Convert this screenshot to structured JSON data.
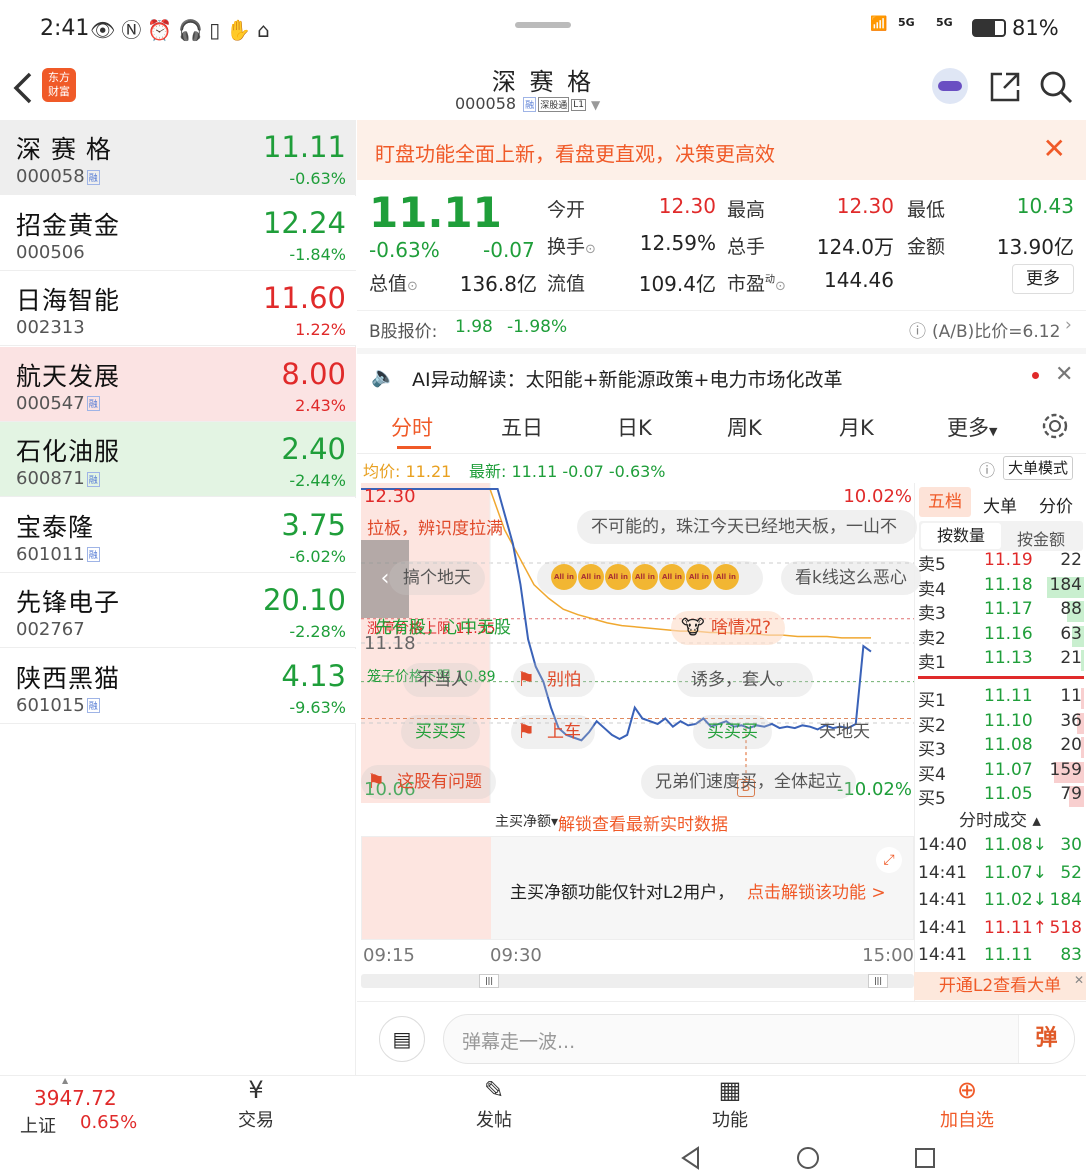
{
  "status": {
    "time": "2:41",
    "battery": "81%",
    "net1": "5G",
    "net2": "5G"
  },
  "header": {
    "title": "深 赛 格",
    "code": "000058",
    "tags": [
      "融",
      "深股通",
      "L1"
    ],
    "logo_line1": "东方",
    "logo_line2": "财富"
  },
  "watchlist": [
    {
      "name": "深 赛 格",
      "code": "000058",
      "rong": true,
      "price": "11.11",
      "change": "-0.63%",
      "dir": "down",
      "bg": "#eeeeee"
    },
    {
      "name": "招金黄金",
      "code": "000506",
      "rong": false,
      "price": "12.24",
      "change": "-1.84%",
      "dir": "down",
      "bg": "#ffffff"
    },
    {
      "name": "日海智能",
      "code": "002313",
      "rong": false,
      "price": "11.60",
      "change": "1.22%",
      "dir": "up",
      "bg": "#ffffff"
    },
    {
      "name": "航天发展",
      "code": "000547",
      "rong": true,
      "price": "8.00",
      "change": "2.43%",
      "dir": "up",
      "bg": "#fbe3e3"
    },
    {
      "name": "石化油服",
      "code": "600871",
      "rong": true,
      "price": "2.40",
      "change": "-2.44%",
      "dir": "down",
      "bg": "#e3f4e3"
    },
    {
      "name": "宝泰隆",
      "code": "601011",
      "rong": true,
      "price": "3.75",
      "change": "-6.02%",
      "dir": "down",
      "bg": "#ffffff"
    },
    {
      "name": "先锋电子",
      "code": "002767",
      "rong": false,
      "price": "20.10",
      "change": "-2.28%",
      "dir": "down",
      "bg": "#ffffff"
    },
    {
      "name": "陕西黑猫",
      "code": "601015",
      "rong": true,
      "price": "4.13",
      "change": "-9.63%",
      "dir": "down",
      "bg": "#ffffff"
    }
  ],
  "banner": {
    "text": "盯盘功能全面上新，看盘更直观，决策更高效"
  },
  "quote": {
    "price": "11.11",
    "pct": "-0.63%",
    "chg": "-0.07",
    "open_label": "今开",
    "open": "12.30",
    "high_label": "最高",
    "high": "12.30",
    "low_label": "最低",
    "low": "10.43",
    "turnover_label": "换手",
    "turnover": "12.59%",
    "volume_label": "总手",
    "volume": "124.0万",
    "amount_label": "金额",
    "amount": "13.90亿",
    "mcap_label": "总值",
    "mcap": "136.8亿",
    "float_label": "流值",
    "float": "109.4亿",
    "pe_label": "市盈",
    "pe_sup": "动",
    "pe": "144.46",
    "more": "更多",
    "bshare_label": "B股报价:",
    "bshare_price": "1.98",
    "bshare_pct": "-1.98%",
    "ab_ratio": "(A/B)比价=6.12"
  },
  "ai": {
    "text": "AI异动解读：太阳能+新能源政策+电力市场化改革"
  },
  "tabs": [
    "分时",
    "五日",
    "日K",
    "周K",
    "月K",
    "更多"
  ],
  "chart_header": {
    "avg_label": "均价:",
    "avg": "11.21",
    "latest_label": "最新:",
    "latest": "11.11",
    "chg": "-0.07",
    "pct": "-0.63%",
    "big_order": "大单模式"
  },
  "chart_data": {
    "type": "line",
    "x_ticks": [
      "09:15",
      "09:30",
      "15:00"
    ],
    "y_max_label": "12.30",
    "y_min_label": "10.06",
    "pct_max": "10.02%",
    "pct_min": "-10.02%",
    "ylim": [
      10.06,
      12.3
    ],
    "mid_label": "11.18",
    "price": [
      12.3,
      12.3,
      12.1,
      11.9,
      11.6,
      11.2,
      11.0,
      10.89,
      10.7,
      10.55,
      10.5,
      10.48,
      10.46,
      10.52,
      10.6,
      10.55,
      10.5,
      10.47,
      10.5,
      10.7,
      10.62,
      10.6,
      10.58,
      10.62,
      10.56,
      10.6,
      10.57,
      10.58,
      10.62,
      10.56,
      10.58,
      10.6,
      10.56,
      10.57,
      10.55,
      10.57,
      10.56,
      10.58,
      10.55,
      10.56,
      10.55,
      10.57,
      10.56,
      10.54,
      10.57,
      10.55,
      10.56,
      10.55,
      10.58,
      11.15,
      11.11
    ],
    "avg": [
      12.3,
      12.0,
      11.8,
      11.6,
      11.5,
      11.42,
      11.38,
      11.35,
      11.32,
      11.3,
      11.29,
      11.28,
      11.27,
      11.26,
      11.26,
      11.25,
      11.25,
      11.24,
      11.24,
      11.23,
      11.23,
      11.22,
      11.22,
      11.22,
      11.21,
      11.21,
      11.21
    ]
  },
  "chart_notes": {
    "limit_up": "涨停价格上限",
    "limit_up_val": "11.35",
    "limit_down": "笼子价格下限",
    "limit_down_val": "10.89",
    "b_marker": "B"
  },
  "danmu": [
    "拉板，辨识度拉满",
    "不可能的，珠江今天已经地天板，一山不",
    "搞个地天",
    "看k线这么恶心",
    "先有股，心中无股",
    "啥情况?",
    "不当人",
    "别怕",
    "诱多，套人。",
    "买买买",
    "上车",
    "买买买",
    "天地天",
    "这股有问题",
    "兄弟们速度买，全体起立"
  ],
  "allin": "All in",
  "orderbook": {
    "tabs": [
      "五档",
      "大单",
      "分价"
    ],
    "subtabs": [
      "按数量",
      "按金额"
    ],
    "asks": [
      {
        "l": "卖5",
        "p": "11.19",
        "v": "22",
        "w": 0
      },
      {
        "l": "卖4",
        "p": "11.18",
        "v": "184",
        "w": 0.22
      },
      {
        "l": "卖3",
        "p": "11.17",
        "v": "88",
        "w": 0.1
      },
      {
        "l": "卖2",
        "p": "11.16",
        "v": "63",
        "w": 0.07
      },
      {
        "l": "卖1",
        "p": "11.13",
        "v": "21",
        "w": 0.02
      }
    ],
    "bids": [
      {
        "l": "买1",
        "p": "11.11",
        "v": "11",
        "w": 0.02
      },
      {
        "l": "买2",
        "p": "11.10",
        "v": "36",
        "w": 0.04
      },
      {
        "l": "买3",
        "p": "11.08",
        "v": "20",
        "w": 0.02
      },
      {
        "l": "买4",
        "p": "11.07",
        "v": "159",
        "w": 0.18
      },
      {
        "l": "买5",
        "p": "11.05",
        "v": "79",
        "w": 0.09
      }
    ],
    "trades_title": "分时成交",
    "trades": [
      {
        "t": "14:40",
        "p": "11.08↓",
        "v": "30",
        "d": "down"
      },
      {
        "t": "14:41",
        "p": "11.07↓",
        "v": "52",
        "d": "down"
      },
      {
        "t": "14:41",
        "p": "11.02↓",
        "v": "184",
        "d": "down"
      },
      {
        "t": "14:41",
        "p": "11.11↑",
        "v": "518",
        "d": "up"
      },
      {
        "t": "14:41",
        "p": "11.11",
        "v": "83",
        "d": "down"
      }
    ],
    "l2": "开通L2查看大单"
  },
  "subchart": {
    "selector": "主买净额",
    "unlock": "解锁查看最新实时数据",
    "notice": "主买净额功能仅针对L2用户，",
    "notice_link": "点击解锁该功能 >"
  },
  "comment": {
    "placeholder": "弹幕走一波...",
    "danmu_btn": "弹"
  },
  "bottom_nav": {
    "index_value": "3947.72",
    "index_name": "上证",
    "index_pct": "0.65%",
    "trade": "交易",
    "post": "发帖",
    "func": "功能",
    "add": "加自选"
  },
  "colors": {
    "up": "#e02a2a",
    "down": "#1f9e3a",
    "accent": "#f36b21",
    "price_line": "#3a62b8",
    "avg_line": "#f0a830"
  }
}
